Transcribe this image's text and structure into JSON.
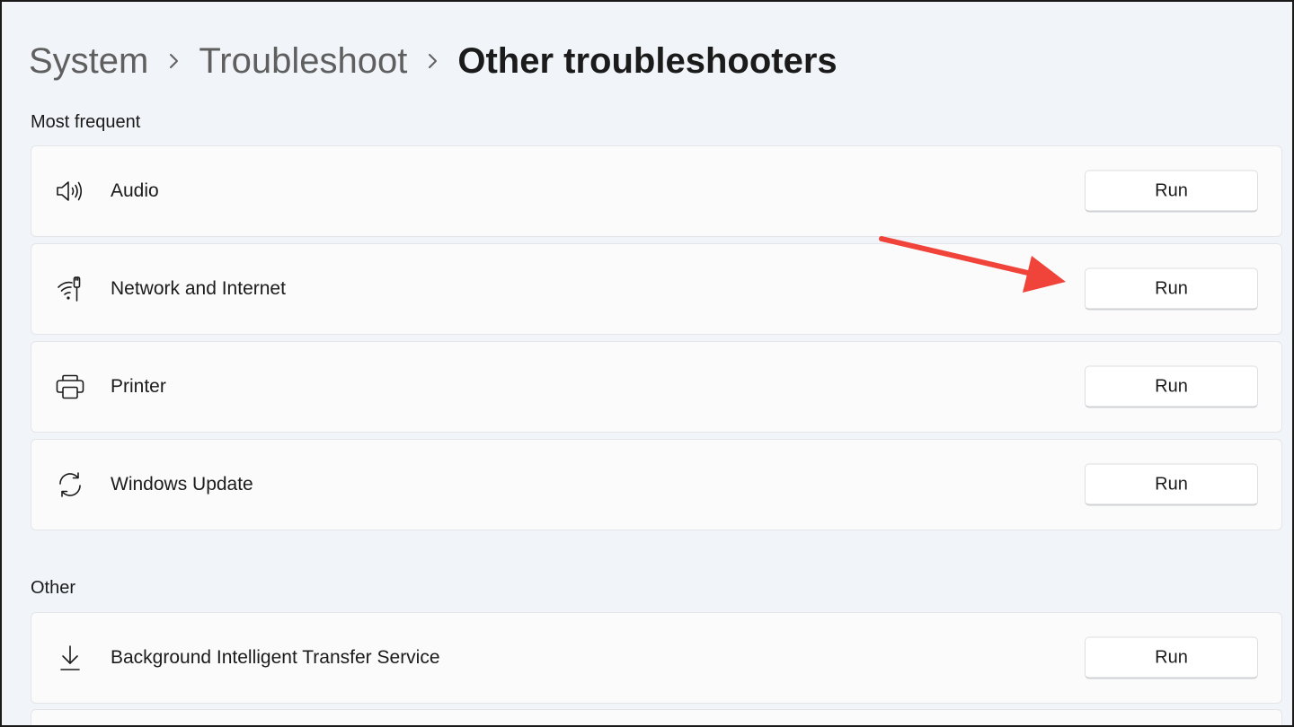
{
  "breadcrumb": {
    "items": [
      "System",
      "Troubleshoot",
      "Other troubleshooters"
    ]
  },
  "sections": {
    "most_frequent": {
      "title": "Most frequent",
      "items": [
        {
          "label": "Audio",
          "icon": "speaker-icon",
          "button": "Run"
        },
        {
          "label": "Network and Internet",
          "icon": "network-icon",
          "button": "Run"
        },
        {
          "label": "Printer",
          "icon": "printer-icon",
          "button": "Run"
        },
        {
          "label": "Windows Update",
          "icon": "sync-icon",
          "button": "Run"
        }
      ]
    },
    "other": {
      "title": "Other",
      "items": [
        {
          "label": "Background Intelligent Transfer Service",
          "icon": "download-icon",
          "button": "Run"
        }
      ]
    }
  },
  "annotation": {
    "arrow_color": "#f0443a"
  }
}
